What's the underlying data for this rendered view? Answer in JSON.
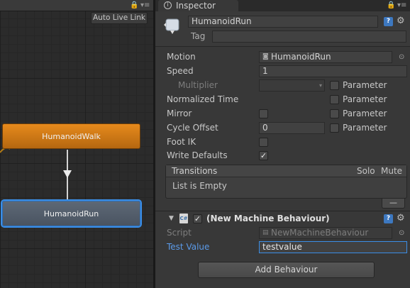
{
  "animator": {
    "auto_live_link": "Auto Live Link",
    "nodes": [
      {
        "label": "HumanoidWalk",
        "color": "#d07a16"
      },
      {
        "label": "HumanoidRun",
        "color": "#556070"
      }
    ]
  },
  "inspector": {
    "tab_label": "Inspector",
    "object_name": "HumanoidRun",
    "tag_label": "Tag",
    "tag_value": "",
    "properties": {
      "motion_label": "Motion",
      "motion_value": "HumanoidRun",
      "speed_label": "Speed",
      "speed_value": "1",
      "multiplier_label": "Multiplier",
      "normalized_time_label": "Normalized Time",
      "mirror_label": "Mirror",
      "cycle_offset_label": "Cycle Offset",
      "cycle_offset_value": "0",
      "foot_ik_label": "Foot IK",
      "write_defaults_label": "Write Defaults",
      "parameter_label": "Parameter"
    },
    "transitions": {
      "title": "Transitions",
      "solo": "Solo",
      "mute": "Mute",
      "empty_text": "List is Empty",
      "remove_symbol": "—"
    },
    "behaviour": {
      "title": "(New Machine Behaviour)",
      "script_label": "Script",
      "script_value": "NewMachineBehaviour",
      "test_value_label": "Test Value",
      "test_value": "testvalue"
    },
    "add_behaviour": "Add Behaviour"
  },
  "colors": {
    "accent_blue": "#3b8ee6",
    "link_blue": "#5b9ae8",
    "state_orange": "#d07a16"
  }
}
